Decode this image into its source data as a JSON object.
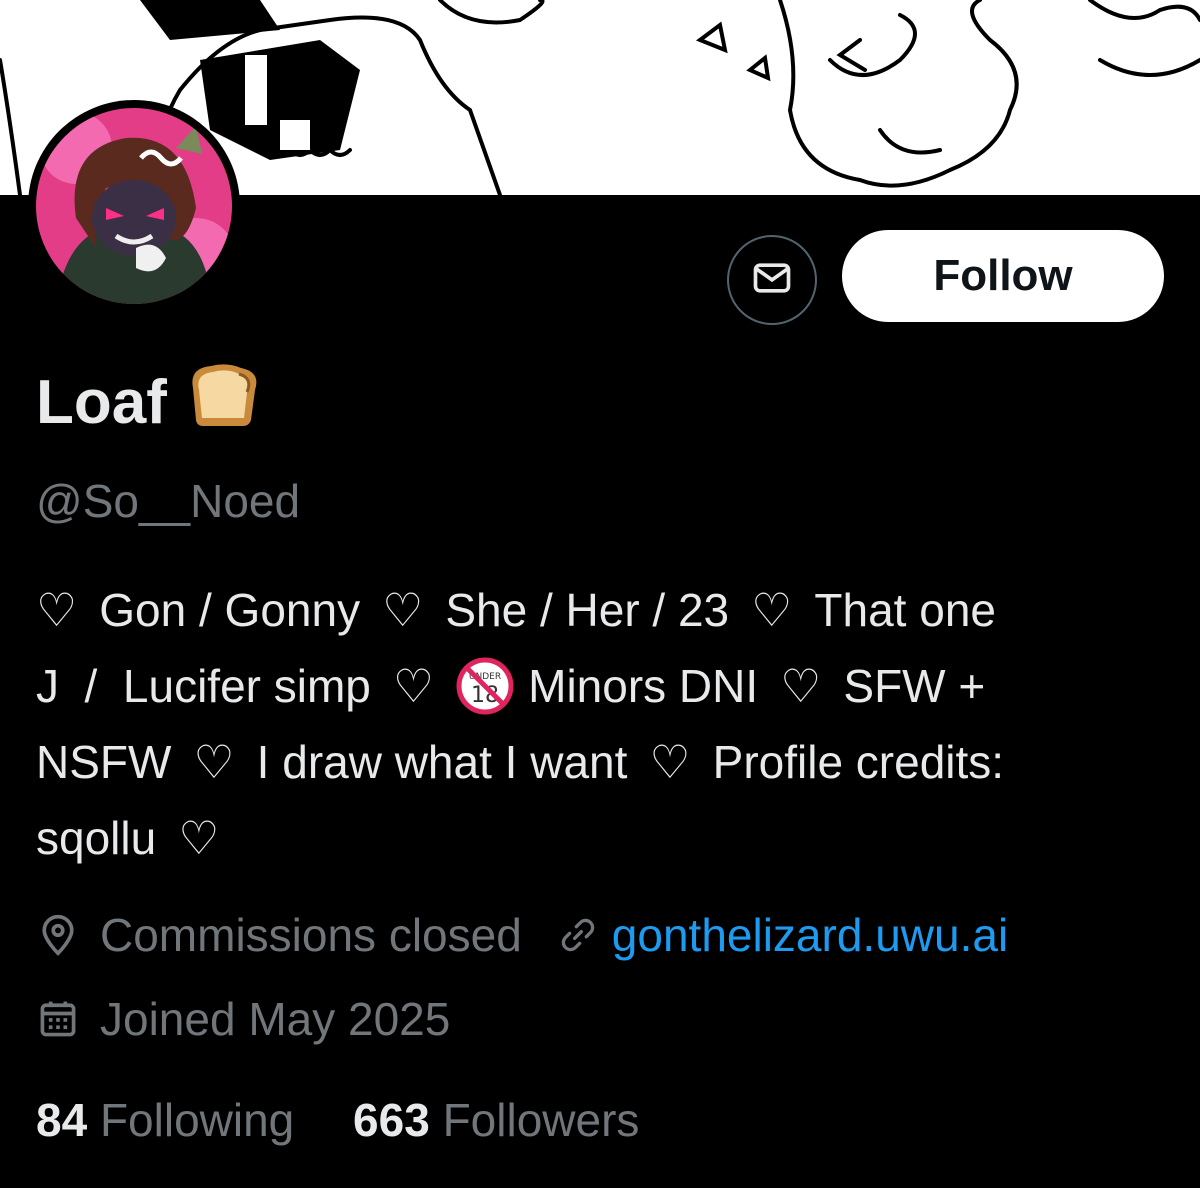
{
  "profile": {
    "display_name": "Loaf",
    "name_emoji_icon": "bread-emoji-icon",
    "handle": "@So__Noed"
  },
  "actions": {
    "message_icon": "envelope-icon",
    "follow_label": "Follow"
  },
  "bio": {
    "separator": "♡",
    "line1": [
      "Gon / Gonny",
      "She / Her / 23",
      "That one"
    ],
    "line2_a": "J  /  Lucifer simp",
    "line2_badge_icon": "under-18-prohibited-icon",
    "line2_b": "Minors DNI",
    "line2_c": "SFW +",
    "line3": [
      "NSFW",
      "I draw what I want",
      "Profile credits:"
    ],
    "line4": "sqollu"
  },
  "meta": {
    "location_icon": "location-pin-icon",
    "location": "Commissions closed",
    "link_icon": "link-icon",
    "link": "gonthelizard.uwu.ai",
    "calendar_icon": "calendar-icon",
    "joined": "Joined May 2025"
  },
  "stats": {
    "following_count": "84",
    "following_label": "Following",
    "followers_count": "663",
    "followers_label": "Followers"
  },
  "colors": {
    "background": "#000000",
    "text_primary": "#e7e9ea",
    "text_secondary": "#71767b",
    "link": "#1d9bf0",
    "follow_button_bg": "#ffffff"
  }
}
